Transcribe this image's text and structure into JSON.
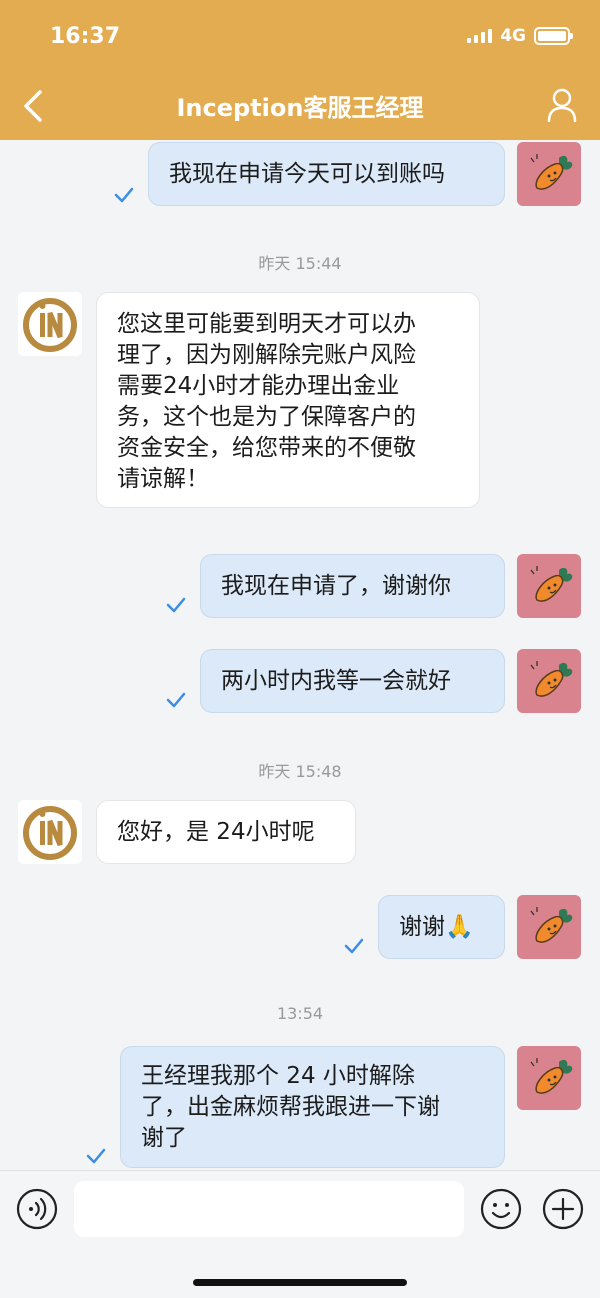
{
  "status_bar": {
    "time": "16:37",
    "network": "4G"
  },
  "header": {
    "title": "Inception客服王经理"
  },
  "messages": [
    {
      "side": "out",
      "lines": [
        "我现在申请今天可以到账吗"
      ]
    },
    {
      "side": "in",
      "lines": [
        "您这里可能要到明天才可以办",
        "理了，因为刚解除完账户风险",
        "需要24小时才能办理出金业",
        "务，这个也是为了保障客户的",
        "资金安全，给您带来的不便敬",
        "请谅解！"
      ]
    },
    {
      "side": "out",
      "lines": [
        "我现在申请了，谢谢你"
      ]
    },
    {
      "side": "out",
      "lines": [
        "两小时内我等一会就好"
      ]
    },
    {
      "side": "in",
      "lines": [
        "您好，是 24小时呢"
      ]
    },
    {
      "side": "out",
      "lines": [
        "谢谢🙏"
      ]
    },
    {
      "side": "out",
      "lines": [
        "王经理我那个 24 小时解除",
        "了，出金麻烦帮我跟进一下谢",
        "谢了"
      ]
    }
  ],
  "timestamps": [
    "昨天 15:44",
    "昨天 15:48",
    "13:54"
  ],
  "input": {
    "placeholder": ""
  },
  "colors": {
    "header": "#e3ac51",
    "outgoing_bubble": "#dbe9f8",
    "incoming_bubble": "#ffffff",
    "check": "#3a8ee6"
  },
  "icons": {
    "back": "chevron-left-icon",
    "profile": "person-icon",
    "voice": "voice-icon",
    "emoji": "smiley-icon",
    "plus": "plus-icon",
    "read": "check-icon"
  }
}
